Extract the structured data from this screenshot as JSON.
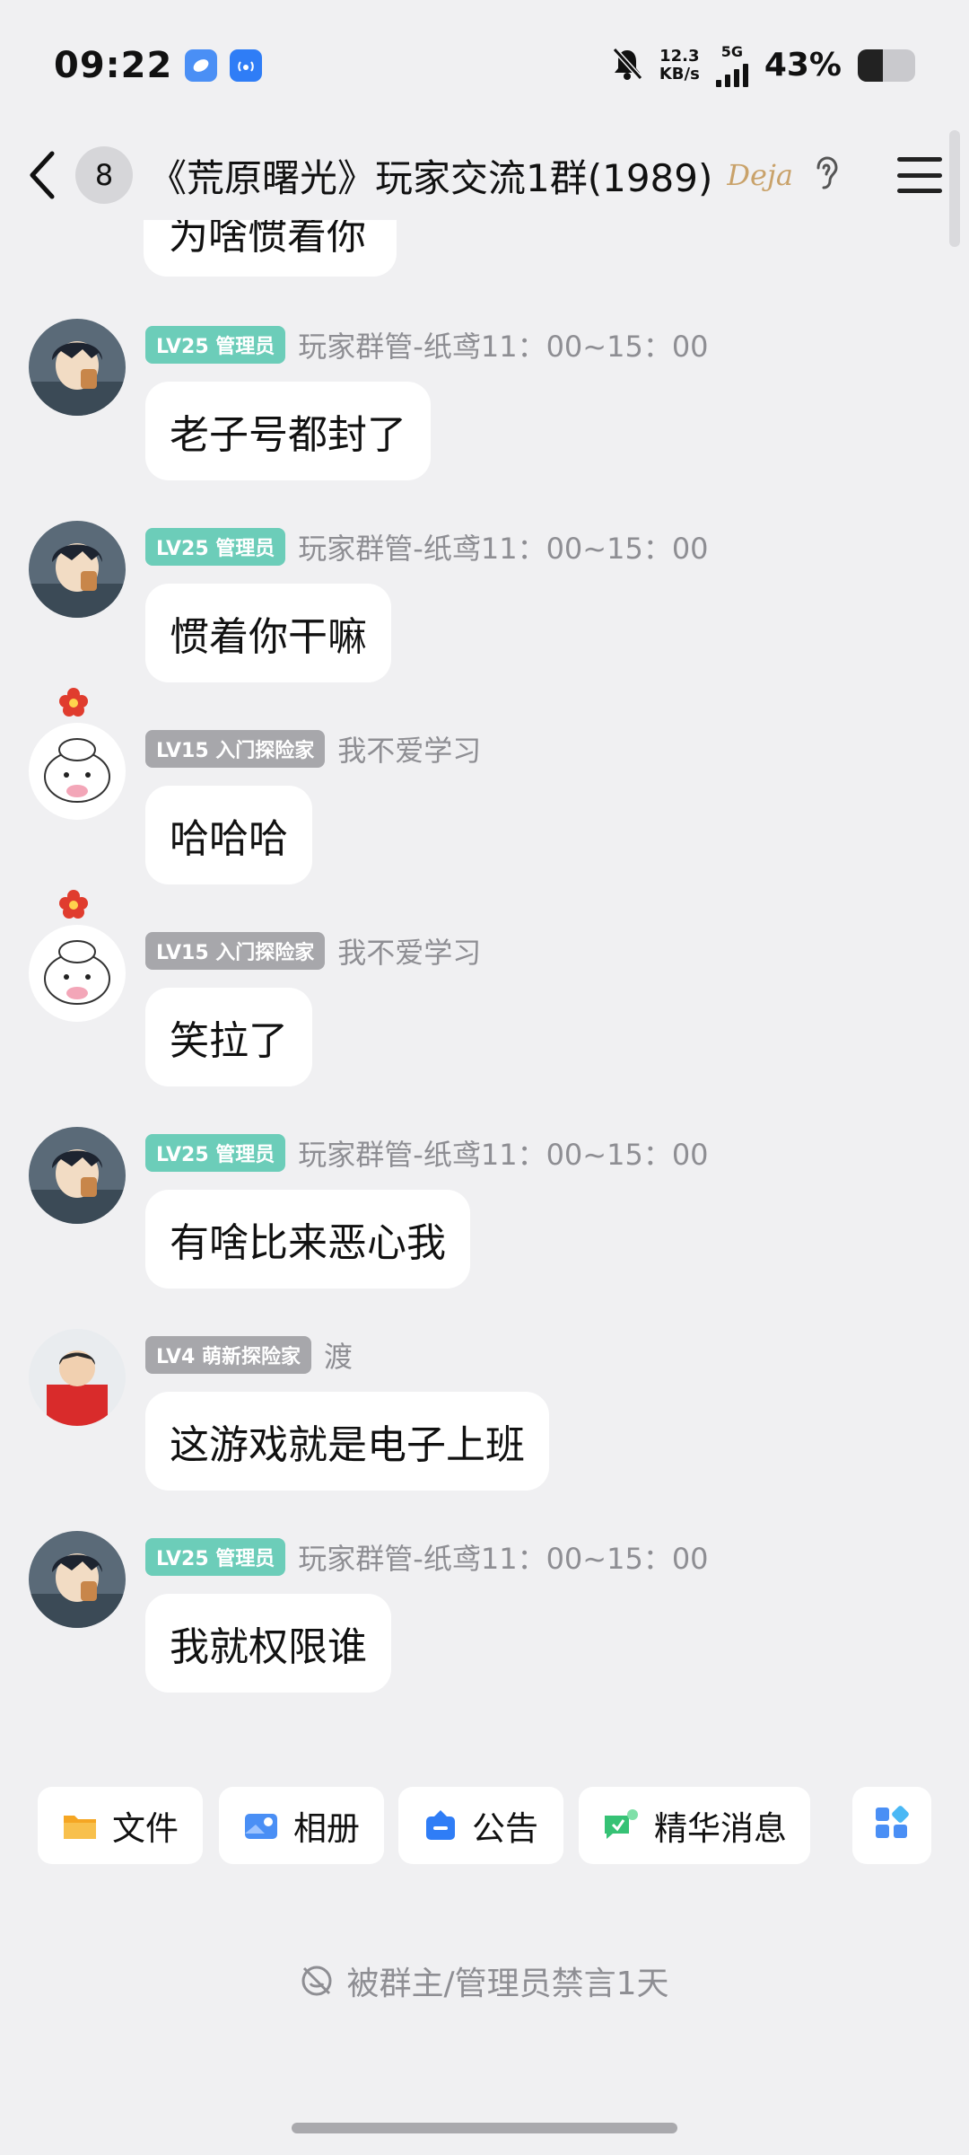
{
  "status": {
    "time": "09:22",
    "net_speed_value": "12.3",
    "net_speed_unit": "KB/s",
    "signal_label": "5G",
    "battery_percent_text": "43%",
    "battery_level": 0.43
  },
  "header": {
    "unread_count": "8",
    "title": "《荒原曙光》玩家交流1群(1989)",
    "logo_text": "Deja"
  },
  "messages": {
    "partial_text": "为啥惯着你",
    "items": [
      {
        "level": "LV25 管理员",
        "level_color": "#6ccdb9",
        "name": "玩家群管-纸鸢11：00~15：00",
        "text": "老子号都封了",
        "avatar": "boy"
      },
      {
        "level": "LV25 管理员",
        "level_color": "#6ccdb9",
        "name": "玩家群管-纸鸢11：00~15：00",
        "text": "惯着你干嘛",
        "avatar": "boy"
      },
      {
        "level": "LV15 入门探险家",
        "level_color": "#a7a7ab",
        "name": "我不爱学习",
        "text": "哈哈哈",
        "avatar": "kitty"
      },
      {
        "level": "LV15 入门探险家",
        "level_color": "#a7a7ab",
        "name": "我不爱学习",
        "text": "笑拉了",
        "avatar": "kitty"
      },
      {
        "level": "LV25 管理员",
        "level_color": "#6ccdb9",
        "name": "玩家群管-纸鸢11：00~15：00",
        "text": "有啥比来恶心我",
        "avatar": "boy"
      },
      {
        "level": "LV4 萌新探险家",
        "level_color": "#a7a7ab",
        "name": "渡",
        "text": "这游戏就是电子上班",
        "avatar": "kid"
      },
      {
        "level": "LV25 管理员",
        "level_color": "#6ccdb9",
        "name": "玩家群管-纸鸢11：00~15：00",
        "text": "我就权限谁",
        "avatar": "boy"
      }
    ]
  },
  "toolbar": {
    "files": "文件",
    "album": "相册",
    "notice": "公告",
    "highlights": "精华消息"
  },
  "mute_notice": "被群主/管理员禁言1天",
  "colors": {
    "admin_badge": "#6ccdb9",
    "member_badge": "#a7a7ab",
    "background": "#f0f0f2"
  }
}
